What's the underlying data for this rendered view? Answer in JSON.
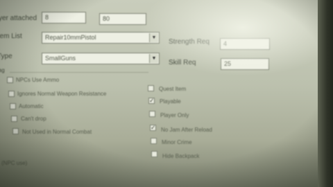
{
  "form": {
    "top_row": {
      "label": "yer attached",
      "value1": "8",
      "value2": "80"
    },
    "item_list": {
      "label": "Item List",
      "value": "Repair10mmPistol"
    },
    "strength_req": {
      "label": "Strength Req",
      "value": "4"
    },
    "type": {
      "label": "Type",
      "value": "SmallGuns"
    },
    "skill_req": {
      "label": "Skill Req",
      "value": "25"
    },
    "group_label": "lag",
    "left_checks": [
      {
        "label": "NPCs Use Ammo",
        "checked": false
      },
      {
        "label": "Ignores Normal Weapon Resistance",
        "checked": false
      },
      {
        "label": "Automatic",
        "checked": false
      },
      {
        "label": "Can't drop",
        "checked": false
      },
      {
        "label": "Not Used in Normal Combat",
        "checked": false
      }
    ],
    "right_checks": [
      {
        "label": "Quest Item",
        "checked": false
      },
      {
        "label": "Playable",
        "checked": true
      },
      {
        "label": "Player Only",
        "checked": false
      },
      {
        "label": "No Jam After Reload",
        "checked": true
      },
      {
        "label": "Minor Crime",
        "checked": false
      },
      {
        "label": "Hide Backpack",
        "checked": false
      }
    ],
    "bottom_text": "(NPC use)"
  },
  "icons": {
    "dropdown": "chevron-down-icon",
    "checkmark": "check-icon"
  }
}
